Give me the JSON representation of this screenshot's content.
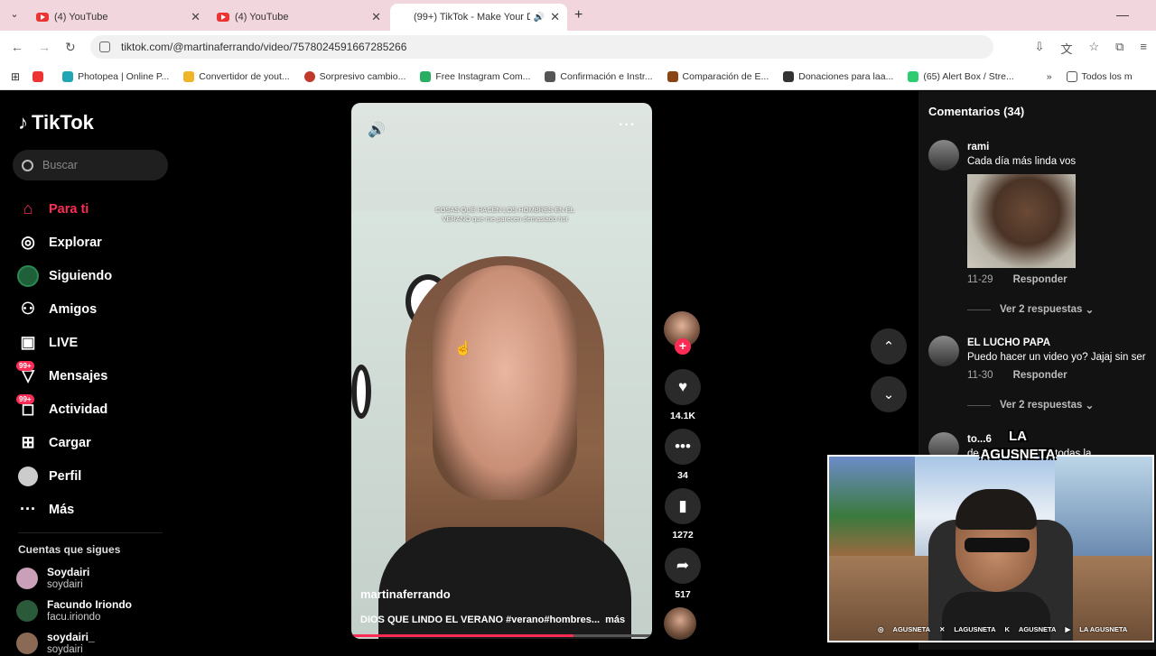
{
  "browser": {
    "tabs": [
      {
        "title": "(4) YouTube",
        "icon": "youtube-icon"
      },
      {
        "title": "(4) YouTube",
        "icon": "youtube-icon"
      },
      {
        "title": "(99+) TikTok - Make Your Da",
        "icon": "tiktok-icon",
        "active": true
      }
    ],
    "url": "tiktok.com/@martinaferrando/video/7578024591667285266",
    "bookmarks": [
      {
        "label": "Photopea | Online P...",
        "color": "#22a6b3"
      },
      {
        "label": "Convertidor de yout...",
        "color": "#f0b428"
      },
      {
        "label": "Sorpresivo cambio...",
        "color": "#c0392b"
      },
      {
        "label": "Free Instagram Com...",
        "color": "#27ae60"
      },
      {
        "label": "Confirmación e Instr...",
        "color": "#555555"
      },
      {
        "label": "Comparación de E...",
        "color": "#8b4513"
      },
      {
        "label": "Donaciones para laa...",
        "color": "#333333"
      },
      {
        "label": "(65) Alert Box / Stre...",
        "color": "#2ecc71"
      }
    ],
    "bookmarks_folder": "Todos los m"
  },
  "sidebar": {
    "logo": "TikTok",
    "search_placeholder": "Buscar",
    "nav": [
      {
        "label": "Para ti",
        "icon": "home-icon",
        "active": true
      },
      {
        "label": "Explorar",
        "icon": "compass-icon"
      },
      {
        "label": "Siguiendo",
        "icon": "following-avatar-icon"
      },
      {
        "label": "Amigos",
        "icon": "friends-icon"
      },
      {
        "label": "LIVE",
        "icon": "live-icon"
      },
      {
        "label": "Mensajes",
        "icon": "messages-icon",
        "badge": "99+"
      },
      {
        "label": "Actividad",
        "icon": "activity-icon",
        "badge": "99+"
      },
      {
        "label": "Cargar",
        "icon": "upload-icon"
      },
      {
        "label": "Perfil",
        "icon": "profile-icon"
      },
      {
        "label": "Más",
        "icon": "more-icon"
      }
    ],
    "following_heading": "Cuentas que sigues",
    "following": [
      {
        "name": "Soydairi",
        "handle": "soydairi"
      },
      {
        "name": "Facundo Iriondo",
        "handle": "facu.iriondo"
      },
      {
        "name": "soydairi_",
        "handle": "soydairi"
      }
    ]
  },
  "video": {
    "caption_overlay": "COSAS QUE HACEN LOS HOMBRES EN EL VERANO que me parecen demasiado hot",
    "author": "martinaferrando",
    "description": "DIOS QUE LINDO EL VERANO  #verano#hombres...",
    "more_label": "más",
    "progress": 0.74
  },
  "actions": {
    "likes": "14.1K",
    "comments": "34",
    "saves": "1272",
    "shares": "517"
  },
  "comments": {
    "title": "Comentarios (34)",
    "items": [
      {
        "user": "rami",
        "text": "Cada día más linda vos",
        "date": "11-29",
        "reply": "Responder",
        "view_replies": "Ver 2 respuestas"
      },
      {
        "user": "EL LUCHO PAPA",
        "text": "Puedo hacer un video yo? Jajaj sin ser",
        "date": "11-30",
        "reply": "Responder",
        "view_replies": "Ver 2 respuestas"
      },
      {
        "user": "to...6",
        "text": "de linda superas a todas la"
      }
    ]
  },
  "overlay": {
    "logo": "LA AGUSNETA",
    "socials": [
      "AGUSNETA",
      "LAGUSNETA",
      "AGUSNETA",
      "LA AGUSNETA"
    ]
  }
}
